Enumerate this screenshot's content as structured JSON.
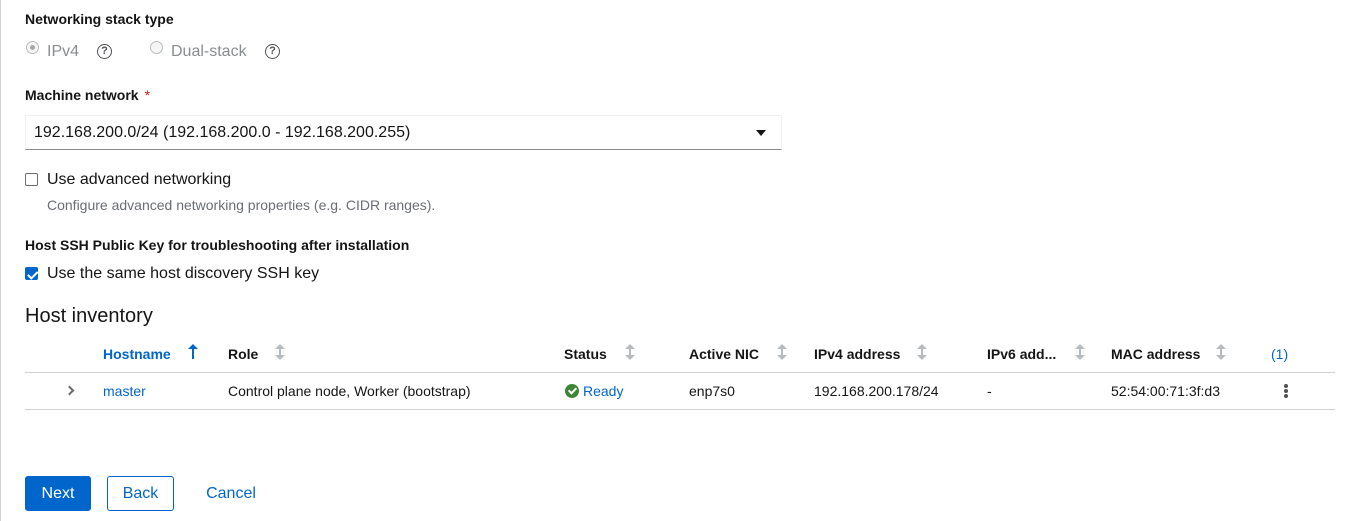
{
  "networking": {
    "stack_type_label": "Networking stack type",
    "options": [
      {
        "label": "IPv4",
        "checked": true
      },
      {
        "label": "Dual-stack",
        "checked": false
      }
    ],
    "help_glyph": "?"
  },
  "machine_network": {
    "label": "Machine network",
    "required_mark": "*",
    "value": "192.168.200.0/24 (192.168.200.0 - 192.168.200.255)"
  },
  "advanced": {
    "label": "Use advanced networking",
    "checked": false,
    "helper": "Configure advanced networking properties (e.g. CIDR ranges)."
  },
  "ssh": {
    "heading": "Host SSH Public Key for troubleshooting after installation",
    "checkbox_label": "Use the same host discovery SSH key",
    "checked": true
  },
  "inventory": {
    "title": "Host inventory",
    "columns": [
      "Hostname",
      "Role",
      "Status",
      "Active NIC",
      "IPv4 address",
      "IPv6 add...",
      "MAC address",
      "(1)"
    ],
    "sorted_column": "Hostname",
    "rows": [
      {
        "hostname": "master",
        "role": "Control plane node, Worker (bootstrap)",
        "status": "Ready",
        "active_nic": "enp7s0",
        "ipv4": "192.168.200.178/24",
        "ipv6": "-",
        "mac": "52:54:00:71:3f:d3"
      }
    ]
  },
  "footer": {
    "next": "Next",
    "back": "Back",
    "cancel": "Cancel"
  },
  "colors": {
    "accent": "#0066cc",
    "success": "#3e8635",
    "required": "#c9190b"
  },
  "icons": [
    "help-icon",
    "caret-down-icon",
    "sort-ascending-icon",
    "sort-icon",
    "chevron-right-icon",
    "check-circle-icon",
    "kebab-icon"
  ]
}
